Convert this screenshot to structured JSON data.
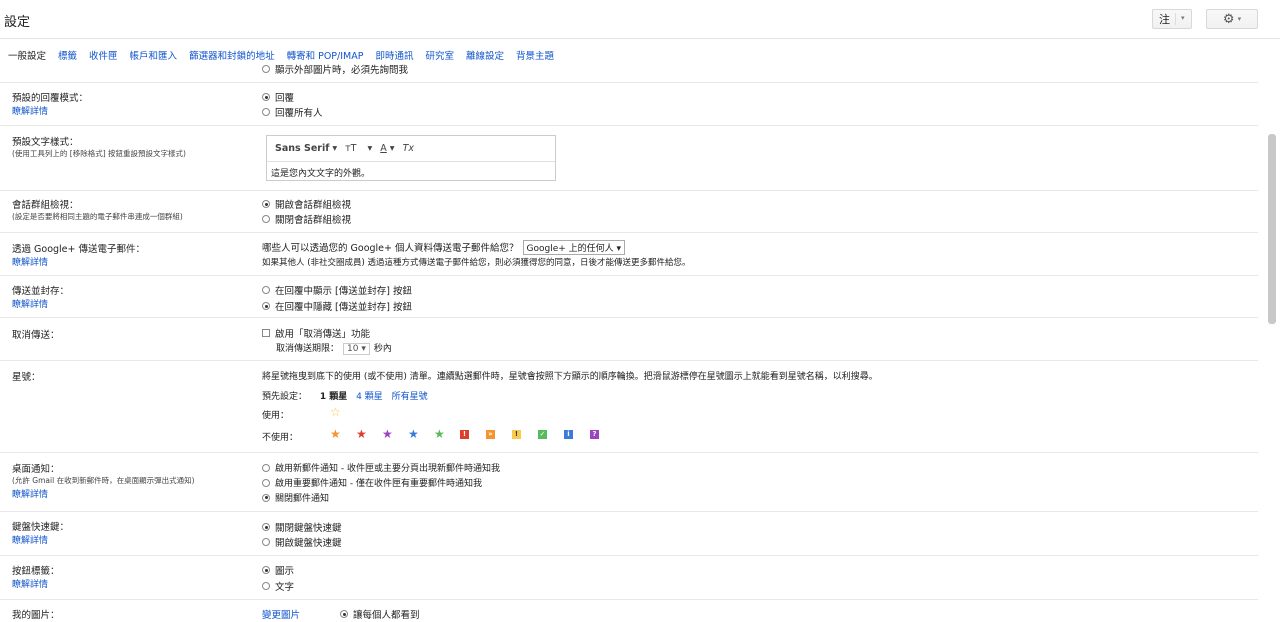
{
  "app": {
    "title": "設定"
  },
  "toolbar": {
    "lang_label": "注",
    "chevron": "▾"
  },
  "tabs": [
    {
      "label": "一般設定"
    },
    {
      "label": "標籤"
    },
    {
      "label": "收件匣"
    },
    {
      "label": "帳戶和匯入"
    },
    {
      "label": "篩選器和封鎖的地址"
    },
    {
      "label": "轉寄和 POP/IMAP"
    },
    {
      "label": "即時通訊"
    },
    {
      "label": "研究室"
    },
    {
      "label": "離線設定"
    },
    {
      "label": "背景主題"
    }
  ],
  "images": {
    "opt_ask": "顯示外部圖片時，必須先詢問我"
  },
  "reply": {
    "label": "預設的回覆模式：",
    "learn": "瞭解詳情",
    "opt_reply": "回覆",
    "opt_reply_all": "回覆所有人"
  },
  "text_style": {
    "label": "預設文字樣式：",
    "sub": "(使用工具列上的 [移除格式] 按鈕重設預設文字樣式)",
    "font": "Sans Serif",
    "size_icon": "ᴛT",
    "color_icon": "A",
    "clear_icon": "Tx",
    "sample": "這是您內文文字的外觀。"
  },
  "conversation": {
    "label": "會話群組檢視：",
    "sub": "(設定是否要將相同主題的電子郵件串連成一個群組)",
    "opt_on": "開啟會話群組檢視",
    "opt_off": "關閉會話群組檢視"
  },
  "gplus": {
    "label": "透過 Google+ 傳送電子郵件：",
    "learn": "瞭解詳情",
    "question": "哪些人可以透過您的 Google+ 個人資料傳送電子郵件給您？",
    "select": "Google+ 上的任何人",
    "note": "如果其他人 (非社交圈成員) 透過這種方式傳送電子郵件給您，則必須獲得您的同意，日後才能傳送更多郵件給您。"
  },
  "send_archive": {
    "label": "傳送並封存：",
    "learn": "瞭解詳情",
    "opt_show": "在回覆中顯示 [傳送並封存] 按鈕",
    "opt_hide": "在回覆中隱藏 [傳送並封存] 按鈕"
  },
  "undo_send": {
    "label": "取消傳送：",
    "opt_enable": "啟用「取消傳送」功能",
    "period_label": "取消傳送期限：",
    "period_value": "10",
    "unit": "秒內"
  },
  "stars": {
    "label": "星號：",
    "desc": "將星號拖曳到底下的使用 (或不使用) 清單。連續點選郵件時，星號會按照下方顯示的順序輪換。把滑鼠游標停在星號圖示上就能看到星號名稱，以利搜尋。",
    "presets_label": "預先設定：",
    "preset_1": "1 顆星",
    "preset_4": "4 顆星",
    "preset_all": "所有星號",
    "in_use_label": "使用：",
    "not_in_use_label": "不使用：",
    "colors": {
      "yellow": "#f7cb4d",
      "orange": "#f6932e",
      "red": "#dd3f2f",
      "purple": "#9c44c0",
      "blue": "#3d7bd9",
      "green": "#57bb5c"
    }
  },
  "desktop": {
    "label": "桌面通知：",
    "sub": "(允許 Gmail 在收到新郵件時，在桌面顯示彈出式通知)",
    "learn": "瞭解詳情",
    "opt_new": "啟用新郵件通知 - 收件匣或主要分頁出現新郵件時通知我",
    "opt_important": "啟用重要郵件通知 - 僅在收件匣有重要郵件時通知我",
    "opt_off": "關閉郵件通知"
  },
  "shortcuts": {
    "label": "鍵盤快速鍵：",
    "learn": "瞭解詳情",
    "opt_off": "關閉鍵盤快速鍵",
    "opt_on": "開啟鍵盤快速鍵"
  },
  "button_labels": {
    "label": "按鈕標籤：",
    "learn": "瞭解詳情",
    "opt_icons": "圖示",
    "opt_text": "文字"
  },
  "picture": {
    "label": "我的圖片：",
    "change": "變更圖片",
    "opt_everyone": "讓每個人都看到"
  }
}
